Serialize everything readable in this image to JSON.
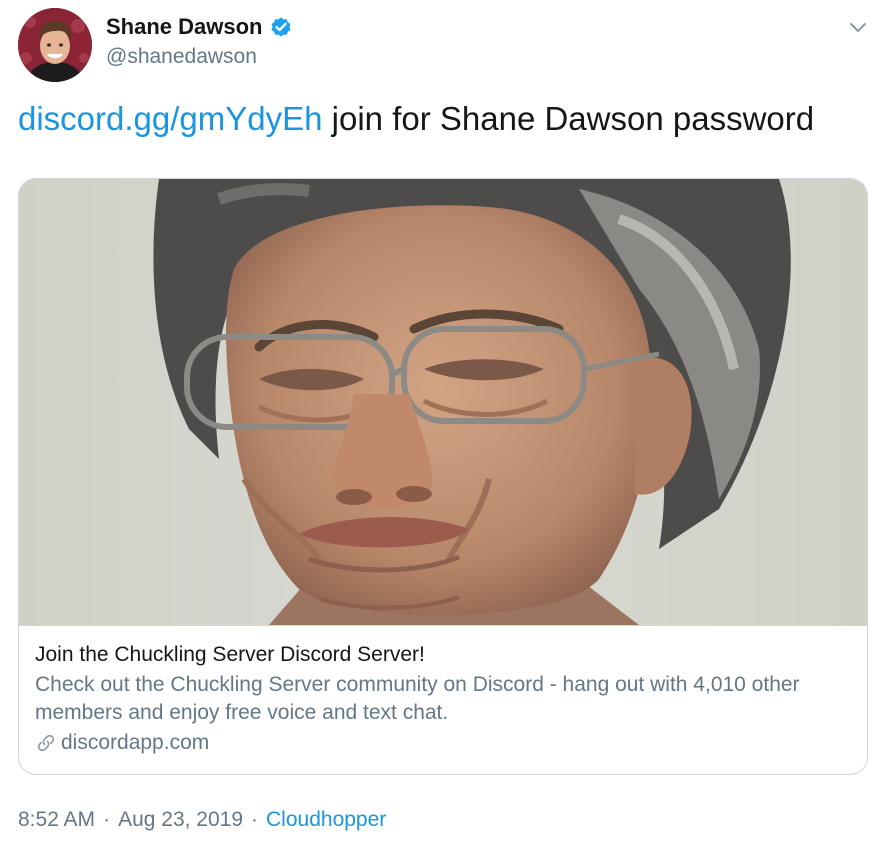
{
  "author": {
    "name": "Shane Dawson",
    "handle": "@shanedawson",
    "verified": true
  },
  "icons": {
    "verified": "verified-badge-icon",
    "menu": "chevron-down-icon",
    "link": "link-icon"
  },
  "tweet": {
    "link_text": "discord.gg/gmYdyEh",
    "text": " join for Shane Dawson password"
  },
  "card": {
    "title": "Join the Chuckling Server Discord Server!",
    "description": "Check out the Chuckling Server community on Discord - hang out with 4,010 other members and enjoy free voice and text chat.",
    "domain": "discordapp.com"
  },
  "meta": {
    "time": "8:52 AM",
    "separator": "·",
    "date": "Aug 23, 2019",
    "source": "Cloudhopper"
  },
  "colors": {
    "link": "#1b95e0",
    "secondary_text": "#657786",
    "border": "#ccd6dd",
    "verified": "#1da1f2"
  }
}
